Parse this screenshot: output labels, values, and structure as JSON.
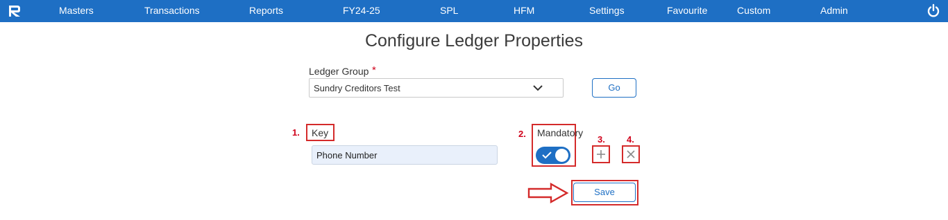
{
  "nav": {
    "logo": "app-logo",
    "items": [
      "Masters",
      "Transactions",
      "Reports",
      "FY24-25",
      "SPL",
      "HFM",
      "Settings",
      "Favourite",
      "Custom",
      "Admin"
    ],
    "power_icon": "power-icon"
  },
  "page": {
    "title": "Configure Ledger Properties"
  },
  "ledger_group": {
    "label": "Ledger Group",
    "required_mark": "*",
    "selected": "Sundry Creditors Test",
    "go_label": "Go"
  },
  "property_row": {
    "key_label": "Key",
    "key_value": "Phone Number",
    "mandatory_label": "Mandatory",
    "mandatory_on": true,
    "add_icon": "plus-icon",
    "remove_icon": "close-icon"
  },
  "annotations": [
    "1.",
    "2.",
    "3.",
    "4."
  ],
  "save_label": "Save",
  "colors": {
    "topbar": "#1e6fc4",
    "annotation_red": "#d42a2a",
    "accent": "#1e6fc4"
  }
}
